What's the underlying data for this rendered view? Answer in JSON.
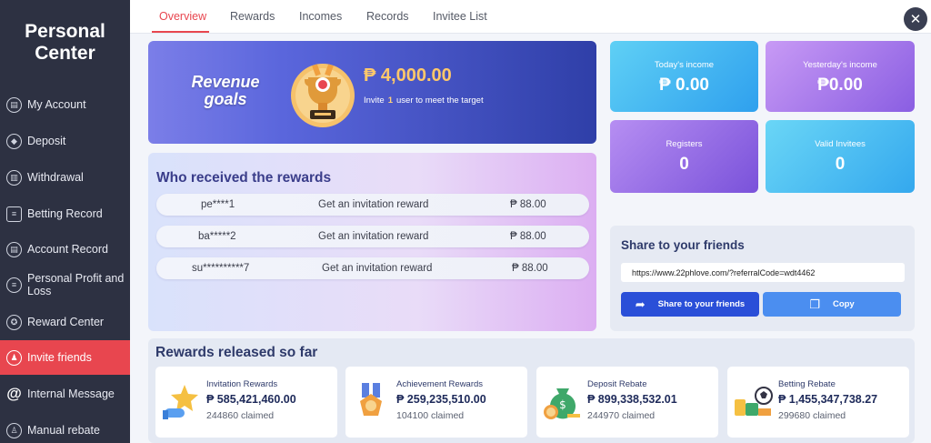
{
  "sidebar": {
    "title": "Personal Center",
    "items": [
      {
        "label": "My Account",
        "icon": "account-icon"
      },
      {
        "label": "Deposit",
        "icon": "deposit-icon"
      },
      {
        "label": "Withdrawal",
        "icon": "withdrawal-icon"
      },
      {
        "label": "Betting Record",
        "icon": "betting-record-icon"
      },
      {
        "label": "Account Record",
        "icon": "account-record-icon"
      },
      {
        "label": "Personal Profit and Loss",
        "icon": "profit-loss-icon"
      },
      {
        "label": "Reward Center",
        "icon": "reward-icon"
      },
      {
        "label": "Invite friends",
        "icon": "invite-icon",
        "active": true
      },
      {
        "label": "Internal Message",
        "icon": "at-icon"
      },
      {
        "label": "Manual rebate",
        "icon": "rebate-icon"
      }
    ]
  },
  "tabs": [
    {
      "label": "Overview",
      "active": true
    },
    {
      "label": "Rewards"
    },
    {
      "label": "Incomes"
    },
    {
      "label": "Records"
    },
    {
      "label": "Invitee List"
    }
  ],
  "revenue": {
    "title": "Revenue goals",
    "amount": "₱ 4,000.00",
    "desc_prefix": "Invite",
    "desc_count": "1",
    "desc_suffix": "user to meet the target"
  },
  "who": {
    "title": "Who received the rewards",
    "rows": [
      {
        "user": "pe****1",
        "text": "Get an invitation reward",
        "amount": "₱ 88.00"
      },
      {
        "user": "ba*****2",
        "text": "Get an invitation reward",
        "amount": "₱ 88.00"
      },
      {
        "user": "su**********7",
        "text": "Get an invitation reward",
        "amount": "₱ 88.00"
      }
    ]
  },
  "stats": {
    "today": {
      "label": "Today's income",
      "value": "₱ 0.00"
    },
    "yesterday": {
      "label": "Yesterday's income",
      "value": "₱0.00"
    },
    "registers": {
      "label": "Registers",
      "value": "0"
    },
    "valid": {
      "label": "Valid Invitees",
      "value": "0"
    }
  },
  "share": {
    "title": "Share to your friends",
    "url": "https://www.22phlove.com/?referralCode=wdt4462",
    "share_button": "Share to your friends",
    "copy_button": "Copy"
  },
  "released": {
    "title": "Rewards released so far",
    "cards": [
      {
        "name": "Invitation Rewards",
        "amount": "₱ 585,421,460.00",
        "claimed": "244860 claimed"
      },
      {
        "name": "Achievement Rewards",
        "amount": "₱ 259,235,510.00",
        "claimed": "104100 claimed"
      },
      {
        "name": "Deposit Rebate",
        "amount": "₱ 899,338,532.01",
        "claimed": "244970 claimed"
      },
      {
        "name": "Betting Rebate",
        "amount": "₱ 1,455,347,738.27",
        "claimed": "299680 claimed"
      }
    ]
  },
  "colors": {
    "accent": "#e8464f",
    "sidebar": "#2d3142"
  }
}
